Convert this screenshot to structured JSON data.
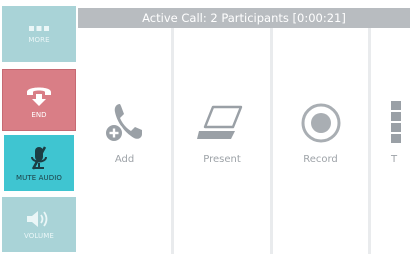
{
  "header": {
    "title": "Active Call: 2 Participants [0:00:21]"
  },
  "sidebar": {
    "more_label": "MORE",
    "end_label": "END",
    "mute_label": "MUTE AUDIO",
    "volume_label": "VOLUME"
  },
  "actions": {
    "add_label": "Add",
    "present_label": "Present",
    "record_label": "Record",
    "fourth_label": "T"
  },
  "colors": {
    "sidebar_inactive": "#a9d3d7",
    "end_call": "#d97e86",
    "mute_active": "#3fc5d1",
    "header": "#b8bcc0"
  }
}
